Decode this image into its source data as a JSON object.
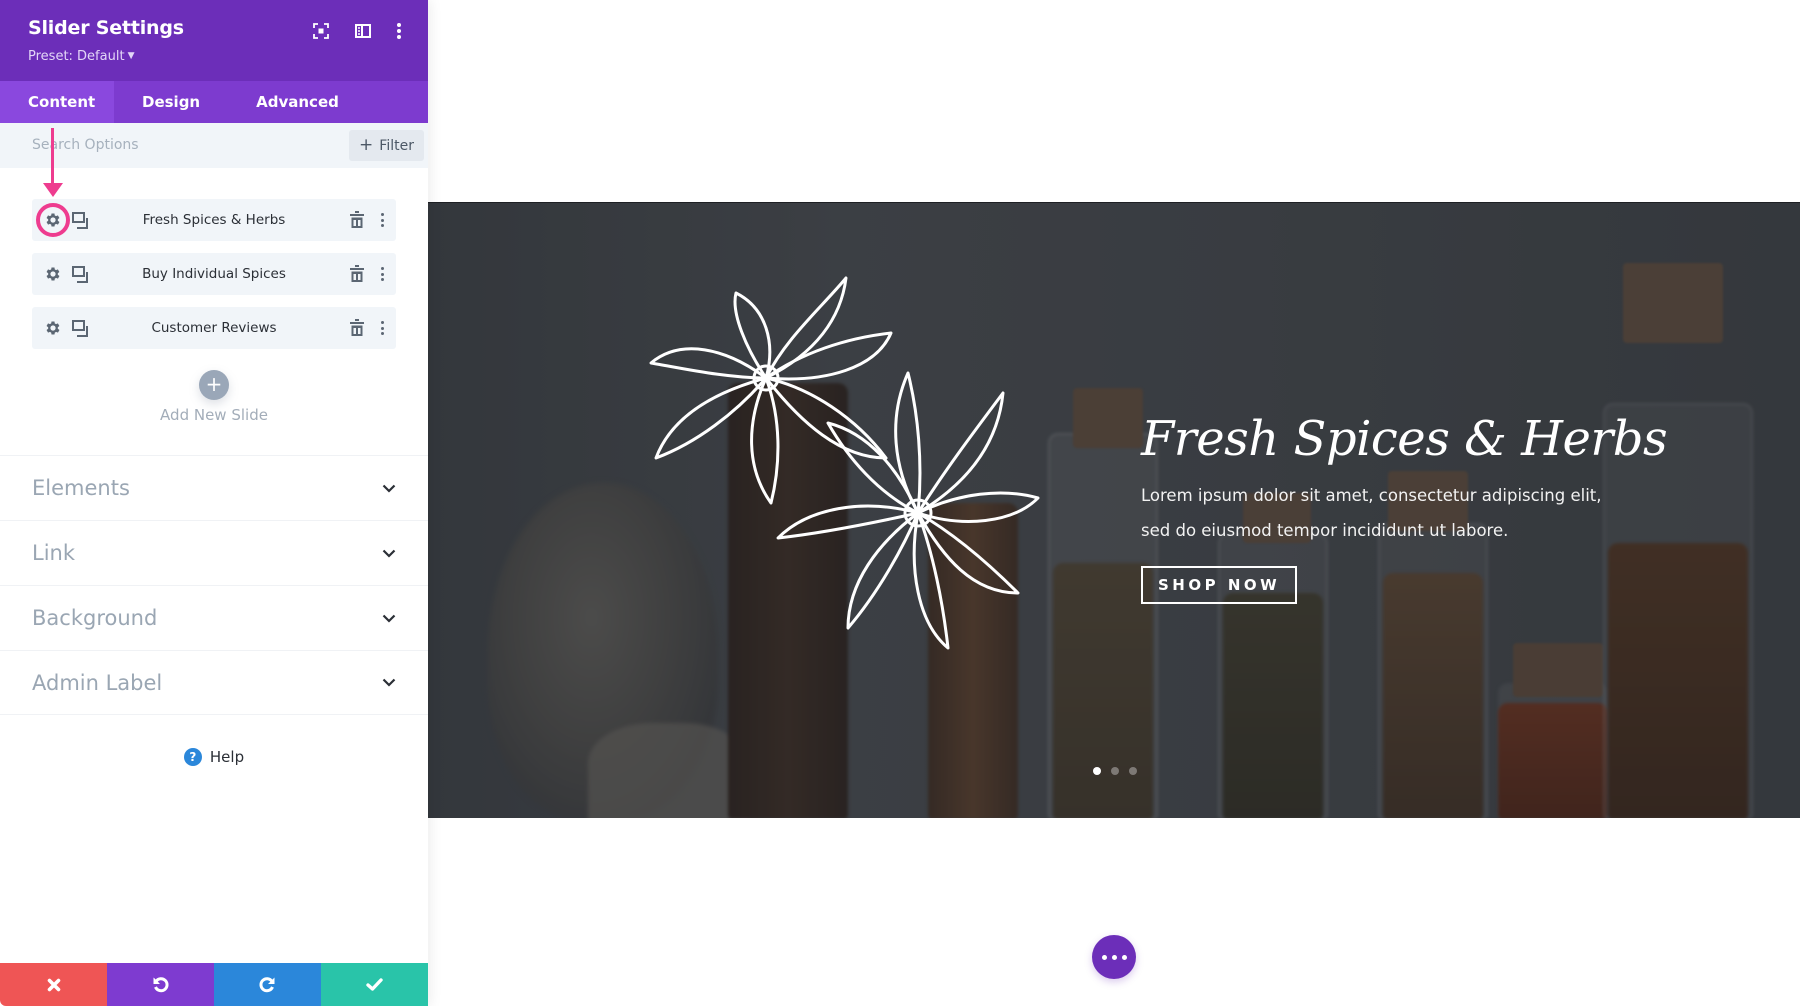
{
  "panel": {
    "title": "Slider Settings",
    "preset": "Preset: Default",
    "header_icons": [
      "focus-mode-icon",
      "split-view-icon",
      "more-options-icon"
    ],
    "tabs": [
      {
        "label": "Content",
        "active": true
      },
      {
        "label": "Design",
        "active": false
      },
      {
        "label": "Advanced",
        "active": false
      }
    ],
    "search": {
      "placeholder": "Search Options",
      "value": ""
    },
    "filter_label": "Filter",
    "slides": [
      {
        "label": "Fresh Spices & Herbs",
        "highlighted": true
      },
      {
        "label": "Buy Individual Spices",
        "highlighted": false
      },
      {
        "label": "Customer Reviews",
        "highlighted": false
      }
    ],
    "add_slide_label": "Add New Slide",
    "sections": [
      {
        "label": "Elements"
      },
      {
        "label": "Link"
      },
      {
        "label": "Background"
      },
      {
        "label": "Admin Label"
      }
    ],
    "help_label": "Help",
    "footer": {
      "cancel": "close-icon",
      "undo": "undo-icon",
      "redo": "redo-icon",
      "save": "check-icon"
    }
  },
  "slider": {
    "title": "Fresh Spices & Herbs",
    "body": "Lorem ipsum dolor sit amet, consectetur adipiscing elit, sed do eiusmod tempor incididunt ut labore.",
    "button_label": "SHOP NOW",
    "slide_count": 3,
    "active_slide": 1
  },
  "colors": {
    "brand_purple": "#6c2eb9",
    "tab_purple": "#7d3bcf",
    "highlight_pink": "#ee3c8f",
    "cancel_red": "#ef5555",
    "undo_purple": "#7e3bd0",
    "redo_blue": "#2b87da",
    "save_green": "#29c4a9"
  }
}
